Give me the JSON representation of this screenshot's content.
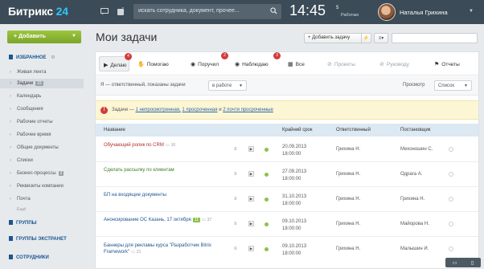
{
  "topbar": {
    "logo_text": "Битрикс",
    "logo_num": "24",
    "counter_a": "1",
    "search_placeholder": "искать сотрудника, документ, прочее...",
    "clock": "14:45",
    "status_num": "5",
    "status_label": "Работаю",
    "username": "Наталья Грихина"
  },
  "sidebar": {
    "add_label": "Добавить",
    "favorites": "ИЗБРАННОЕ",
    "items": [
      {
        "label": "Живая лента",
        "badge": "1"
      },
      {
        "label": "Задачи",
        "badge": "15"
      },
      {
        "label": "Календарь",
        "badge": ""
      },
      {
        "label": "Сообщения",
        "badge": ""
      },
      {
        "label": "Рабочие отчеты",
        "badge": ""
      },
      {
        "label": "Рабочее время",
        "badge": ""
      },
      {
        "label": "Общие документы",
        "badge": ""
      },
      {
        "label": "Списки",
        "badge": ""
      },
      {
        "label": "Бизнес-процессы",
        "badge": "2"
      },
      {
        "label": "Реквизиты компании",
        "badge": ""
      },
      {
        "label": "Почта",
        "badge": ""
      }
    ],
    "more": "Ещё",
    "groups": "ГРУППЫ",
    "extranet": "ГРУППЫ ЭКСТРАНЕТ",
    "employees": "СОТРУДНИКИ"
  },
  "main": {
    "title": "Мои задачи",
    "add_task": "Добавить задачу",
    "tabs": [
      {
        "label": "Делаю",
        "counter": "4"
      },
      {
        "label": "Помогаю",
        "counter": ""
      },
      {
        "label": "Поручил",
        "counter": "2"
      },
      {
        "label": "Наблюдаю",
        "counter": "3"
      },
      {
        "label": "Все",
        "counter": ""
      },
      {
        "label": "Проекты",
        "counter": ""
      },
      {
        "label": "Руководу",
        "counter": ""
      },
      {
        "label": "Отчеты",
        "counter": ""
      }
    ],
    "filter": {
      "text": "Я — ответственный, показаны задачи",
      "status": "в работе",
      "view_label": "Просмотр",
      "view_value": "Список"
    },
    "notice": {
      "prefix": "Задачи —",
      "link1": "1 непросмотренная,",
      "link2": "1 просроченная",
      "and": "и",
      "link3": "2 почти просроченные"
    },
    "columns": [
      "Название",
      "Крайний срок",
      "Ответственный",
      "Постановщик"
    ],
    "rows": [
      {
        "name": "Обучающий ролик по CRM",
        "comments": "16",
        "badge": "",
        "date": "20.09.2013",
        "time": "18:00:00",
        "resp": "Грихина Н.",
        "creator": "Мехоношин С."
      },
      {
        "name": "Сделать рассылку по клиентам",
        "comments": "",
        "badge": "",
        "date": "27.09.2013",
        "time": "18:00:00",
        "resp": "Грихина Н.",
        "creator": "Одрага А."
      },
      {
        "name": "БП на входящие документы",
        "comments": "",
        "badge": "",
        "date": "31.10.2013",
        "time": "18:00:00",
        "resp": "Грихина Н.",
        "creator": "Грихина Н."
      },
      {
        "name": "Анонсирование ОС Казань, 17 октября",
        "comments": "37",
        "badge": "11",
        "date": "09.10.2013",
        "time": "18:00:00",
        "resp": "Грихина Н.",
        "creator": "Майорова Н."
      },
      {
        "name": "Баннеры для рекламы курса \"Разработчик Bitrix Framework\"",
        "comments": "21",
        "badge": "",
        "date": "09.10.2013",
        "time": "18:00:00",
        "resp": "Грихина Н.",
        "creator": "Малышин И."
      }
    ]
  }
}
